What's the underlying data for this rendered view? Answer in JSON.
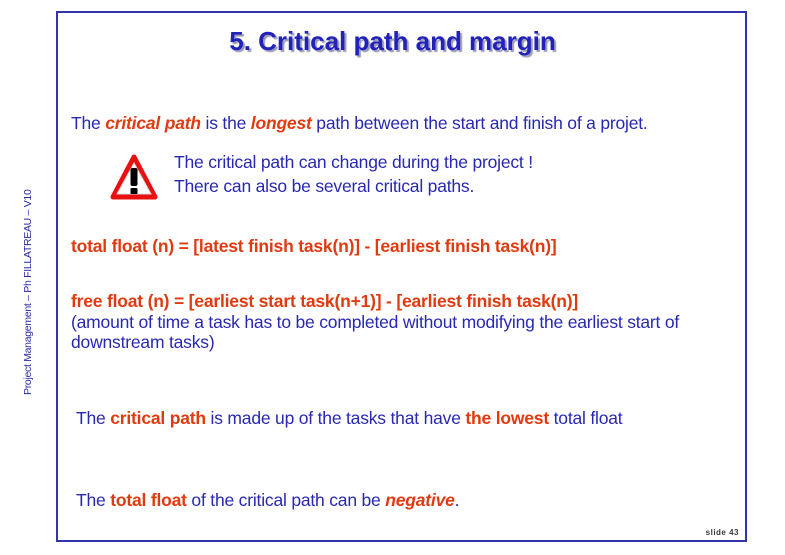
{
  "side_label": "Project Management – Ph FILLATREAU – V10",
  "title": "5. Critical path and margin",
  "intro": {
    "p1": "The ",
    "critical_path": "critical path",
    "p2": " is the ",
    "longest": "longest",
    "p3": " path between the start and finish of a projet."
  },
  "warning": {
    "line1": "The critical path can change during the project !",
    "line2": "There can also be several critical paths."
  },
  "total_float_formula": "total float (n) = [latest finish task(n)] - [earliest finish task(n)]",
  "free_float_formula": "free float (n) = [earliest start task(n+1)] - [earliest finish task(n)]",
  "free_float_note": "(amount of time a task has to be completed without modifying the earliest start of downstream tasks)",
  "statement1": {
    "p1": "The ",
    "critical_path": "critical path",
    "p2": " is made up of the tasks that have ",
    "lowest": "the lowest",
    "p3": " total float"
  },
  "statement2": {
    "p1": "The ",
    "total_float": "total float",
    "p2": " of the critical path can be ",
    "negative": "negative",
    "p3": "."
  },
  "slide_number": "slide 43",
  "colors": {
    "body_text": "#2828b0",
    "highlight": "#e03a10",
    "title": "#2222bb",
    "frame": "#3333aa"
  }
}
